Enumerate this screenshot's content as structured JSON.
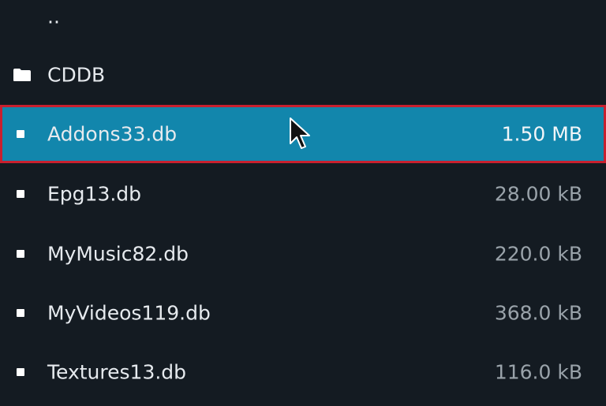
{
  "file_list": {
    "parent": {
      "label": ".."
    },
    "folders": [
      {
        "label": "CDDB",
        "icon": "folder-icon"
      }
    ],
    "files": [
      {
        "label": "Addons33.db",
        "size": "1.50 MB",
        "selected": true,
        "icon": "file-icon"
      },
      {
        "label": "Epg13.db",
        "size": "28.00 kB",
        "selected": false,
        "icon": "file-icon"
      },
      {
        "label": "MyMusic82.db",
        "size": "220.0 kB",
        "selected": false,
        "icon": "file-icon"
      },
      {
        "label": "MyVideos119.db",
        "size": "368.0 kB",
        "selected": false,
        "icon": "file-icon"
      },
      {
        "label": "Textures13.db",
        "size": "116.0 kB",
        "selected": false,
        "icon": "file-icon"
      }
    ]
  },
  "colors": {
    "background": "#141b22",
    "selection": "#1286ac",
    "selection_outline": "#c8202f",
    "text": "#e6eaee",
    "size_text": "#9aa3aa"
  }
}
